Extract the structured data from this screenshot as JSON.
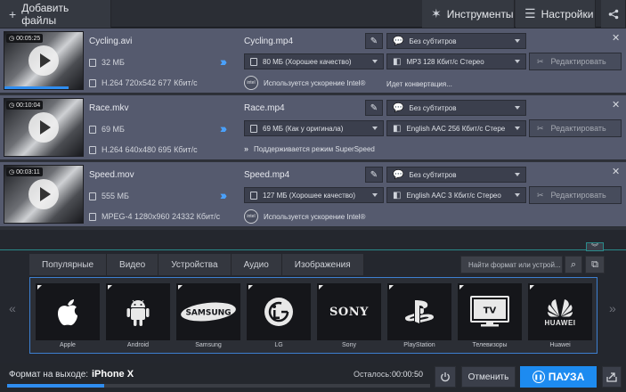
{
  "toolbar": {
    "add_files_label": "Добавить файлы",
    "tools_label": "Инструменты",
    "settings_label": "Настройки"
  },
  "files": [
    {
      "duration": "00:05:25",
      "name": "Cycling.avi",
      "size": "32 МБ",
      "codec_info": "H.264 720x542 677 Кбит/с",
      "progress_percent": 82,
      "output_name": "Cycling.mp4",
      "subtitles": "Без субтитров",
      "output_size": "80 МБ (Хорошее качество)",
      "audio": "MP3 128 Кбит/с Стерео",
      "accel_note": "Используется ускорение Intel®",
      "status": "Идет конвертация...",
      "edit_label": "Редактировать"
    },
    {
      "duration": "00:10:04",
      "name": "Race.mkv",
      "size": "69 МБ",
      "codec_info": "H.264 640x480 695 Кбит/с",
      "progress_percent": 0,
      "output_name": "Race.mp4",
      "subtitles": "Без субтитров",
      "output_size": "69 МБ (Как у оригинала)",
      "audio": "English AAC 256 Кбит/с Стере",
      "accel_note": "Поддерживается режим SuperSpeed",
      "status": "",
      "edit_label": "Редактировать"
    },
    {
      "duration": "00:03:11",
      "name": "Speed.mov",
      "size": "555 МБ",
      "codec_info": "MPEG-4 1280x960 24332 Кбит/с",
      "progress_percent": 0,
      "output_name": "Speed.mp4",
      "subtitles": "Без субтитров",
      "output_size": "127 МБ (Хорошее качество)",
      "audio": "English AAC 3 Кбит/с Стерео",
      "accel_note": "Используется ускорение Intel®",
      "status": "",
      "edit_label": "Редактировать"
    }
  ],
  "format_tabs": [
    "Популярные",
    "Видео",
    "Устройства",
    "Аудио",
    "Изображения"
  ],
  "search": {
    "placeholder": "Найти формат или устрой..."
  },
  "devices": [
    {
      "label": "Apple",
      "logo": "apple-logo"
    },
    {
      "label": "Android",
      "logo": "android-logo"
    },
    {
      "label": "Samsung",
      "logo": "SAMSUNG"
    },
    {
      "label": "LG",
      "logo": "lg-logo"
    },
    {
      "label": "Sony",
      "logo": "SONY"
    },
    {
      "label": "PlayStation",
      "logo": "playstation-logo"
    },
    {
      "label": "Телевизоры",
      "logo": "TV"
    },
    {
      "label": "Huawei",
      "logo": "HUAWEI"
    }
  ],
  "bottom": {
    "format_label": "Формат на выходе:",
    "format_value": "iPhone X",
    "remaining_label": "Осталось:",
    "remaining_value": "00:00:50",
    "cancel_label": "Отменить",
    "pause_label": "ПАУЗА",
    "overall_progress_percent": 23
  },
  "colors": {
    "accent": "#1d8bf0",
    "row_bg": "#555a6e",
    "panel_border": "#3d7fd0"
  }
}
